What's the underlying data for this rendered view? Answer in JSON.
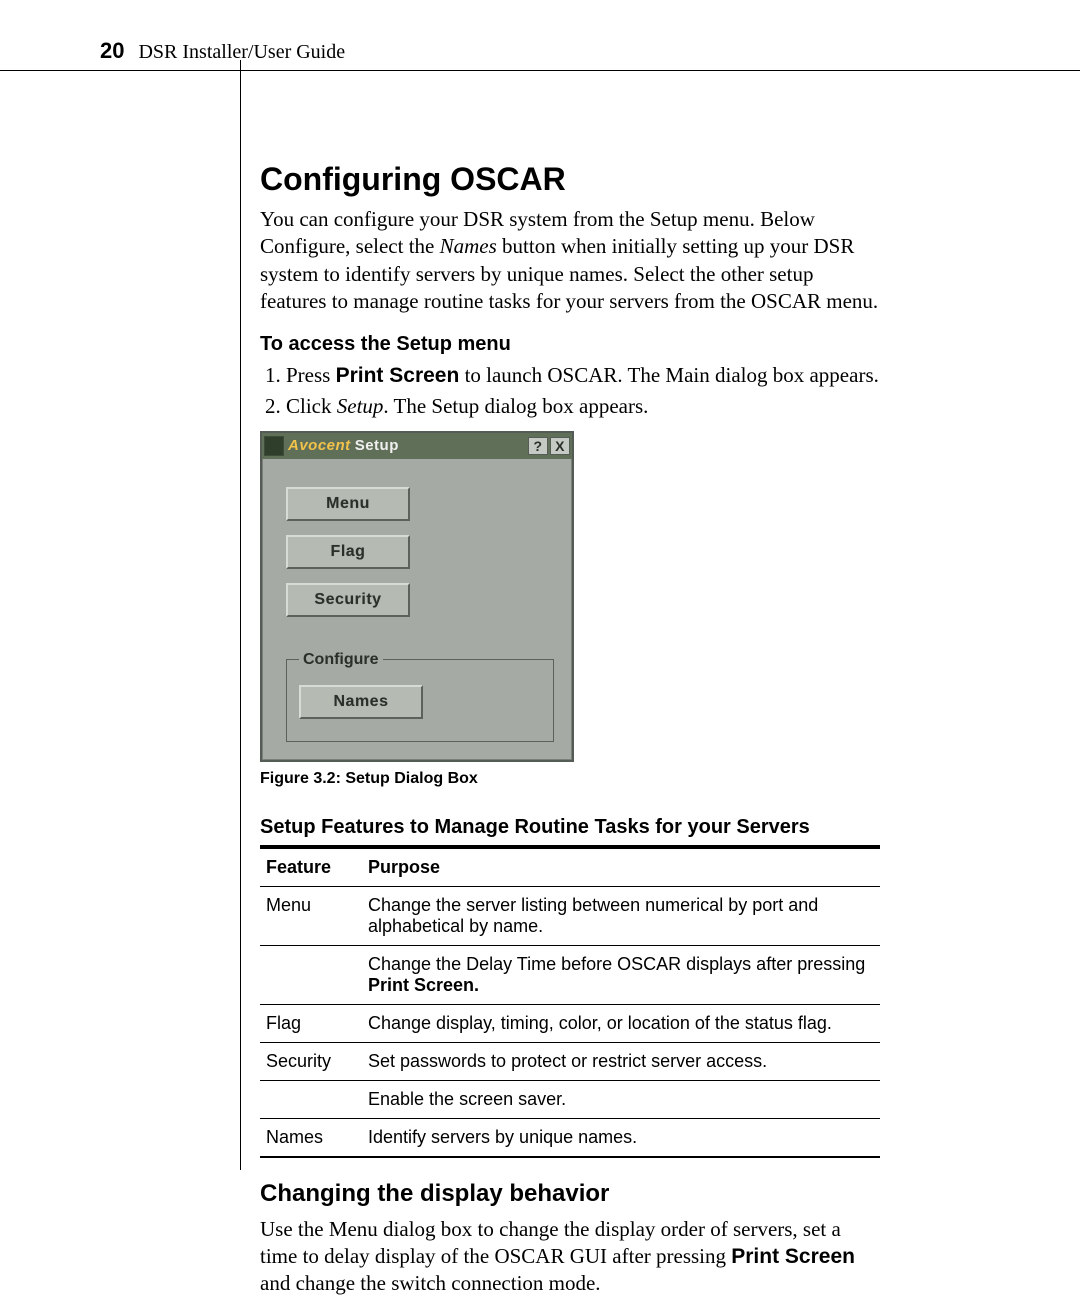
{
  "header": {
    "page_number": "20",
    "doc_title": "DSR Installer/User Guide"
  },
  "section": {
    "title": "Configuring OSCAR",
    "intro_pre": "You can configure your DSR system from the Setup menu. Below Configure, select the ",
    "intro_em": "Names",
    "intro_post": " button when initially setting up your DSR system to identify servers by unique names. Select the other setup features to manage routine tasks for your servers from the OSCAR menu.",
    "access_heading": "To access the Setup menu",
    "step1_pre": "Press ",
    "step1_bold": "Print Screen",
    "step1_post": " to launch OSCAR. The Main dialog box appears.",
    "step2_pre": "Click ",
    "step2_em": "Setup",
    "step2_post": ". The Setup dialog box appears."
  },
  "dialog": {
    "brand": "Avocent",
    "title": "Setup",
    "help_label": "?",
    "close_label": "X",
    "buttons": {
      "menu": "Menu",
      "flag": "Flag",
      "security": "Security",
      "names": "Names"
    },
    "configure_legend": "Configure"
  },
  "figure_caption": "Figure 3.2: Setup Dialog Box",
  "table": {
    "title": "Setup Features to Manage Routine Tasks for your Servers",
    "col_feature": "Feature",
    "col_purpose": "Purpose",
    "rows": [
      {
        "feature": "Menu",
        "purpose": "Change the server listing between numerical by port and alphabetical by name."
      },
      {
        "feature": "",
        "purpose_pre": "Change the Delay Time before OSCAR displays after pressing ",
        "purpose_bold": "Print Screen."
      },
      {
        "feature": "Flag",
        "purpose": "Change display, timing, color, or location of the status flag."
      },
      {
        "feature": "Security",
        "purpose": "Set passwords to protect or restrict server access."
      },
      {
        "feature": "",
        "purpose": "Enable the screen saver."
      },
      {
        "feature": "Names",
        "purpose": "Identify servers by unique names."
      }
    ]
  },
  "section2": {
    "title": "Changing the display behavior",
    "para_pre": "Use the Menu dialog box to change the display order of servers, set a time to delay display of the OSCAR GUI after pressing ",
    "para_bold": "Print Screen",
    "para_post": " and change the switch connection mode."
  }
}
